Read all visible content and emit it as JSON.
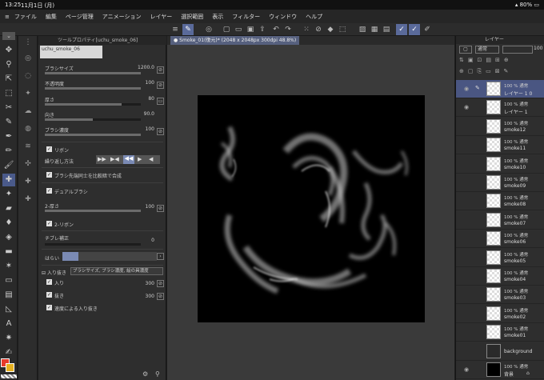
{
  "status": {
    "time": "13:25",
    "date": "11月1日 (月)",
    "battery": "80%"
  },
  "menu": [
    "ファイル",
    "編集",
    "ページ管理",
    "アニメーション",
    "レイヤー",
    "選択範囲",
    "表示",
    "フィルター",
    "ウィンドウ",
    "ヘルプ"
  ],
  "tool_property": {
    "tab_title": "ツールプロパティ[uchu_smoke_06]",
    "preset_name": "uchu_smoke_06",
    "brush_size": {
      "label": "ブラシサイズ",
      "value": "1200.0",
      "fraction": 1.0
    },
    "opacity": {
      "label": "不透明度",
      "value": "100",
      "fraction": 1.0
    },
    "thickness": {
      "label": "厚さ",
      "value": "80",
      "fraction": 0.8
    },
    "direction": {
      "label": "向き",
      "value": "90.0",
      "fraction": 0.5
    },
    "brush_density": {
      "label": "ブラシ濃度",
      "value": "100",
      "fraction": 1.0
    },
    "ribbon": {
      "label": "リボン",
      "checked": true
    },
    "repeat_method": {
      "label": "繰り返し方法"
    },
    "tip_multiply": {
      "label": "ブラシ先端同士を比較暗で合成",
      "checked": true
    },
    "dual_brush": {
      "label": "デュアルブラシ",
      "checked": true
    },
    "thickness2": {
      "label": "2-厚さ",
      "value": "100",
      "fraction": 1.0
    },
    "ribbon2": {
      "label": "2-リボン",
      "checked": true
    },
    "tilt_correction": {
      "label": "チブレ補正",
      "value": "0",
      "fraction": 0.0
    },
    "flick": {
      "label": "はらい"
    },
    "taper": {
      "label": "入り抜き",
      "value": "ブラシサイズ, ブラシ濃度, 絵の具濃度"
    },
    "taper_in": {
      "label": "入り",
      "value": "300",
      "checked": true
    },
    "taper_out": {
      "label": "抜き",
      "value": "300",
      "checked": true
    },
    "speed_taper": {
      "label": "速度による入り抜き",
      "checked": true
    }
  },
  "canvas": {
    "tab_label": "Smoke_01(復元)* (2048 x 2048px 300dpi 48.8%)"
  },
  "layers_panel": {
    "title": "レイヤー",
    "blend_mode": "通常",
    "opacity_value": "100",
    "layers": [
      {
        "opacity": "100 % 通常",
        "name": "レイヤー 1 0",
        "visible": true,
        "thumb": "pen",
        "selected": true
      },
      {
        "opacity": "100 % 通常",
        "name": "レイヤー 1",
        "visible": true,
        "thumb": "checker"
      },
      {
        "opacity": "100 % 通常",
        "name": "smoke12",
        "visible": false,
        "thumb": "checker"
      },
      {
        "opacity": "100 % 通常",
        "name": "smoke11",
        "visible": false,
        "thumb": "checker"
      },
      {
        "opacity": "100 % 通常",
        "name": "smoke10",
        "visible": false,
        "thumb": "checker"
      },
      {
        "opacity": "100 % 通常",
        "name": "smoke09",
        "visible": false,
        "thumb": "checker"
      },
      {
        "opacity": "100 % 通常",
        "name": "smoke08",
        "visible": false,
        "thumb": "checker"
      },
      {
        "opacity": "100 % 通常",
        "name": "smoke07",
        "visible": false,
        "thumb": "checker"
      },
      {
        "opacity": "100 % 通常",
        "name": "smoke06",
        "visible": false,
        "thumb": "checker"
      },
      {
        "opacity": "100 % 通常",
        "name": "smoke05",
        "visible": false,
        "thumb": "checker"
      },
      {
        "opacity": "100 % 通常",
        "name": "smoke04",
        "visible": false,
        "thumb": "checker"
      },
      {
        "opacity": "100 % 通常",
        "name": "smoke03",
        "visible": false,
        "thumb": "checker"
      },
      {
        "opacity": "100 % 通常",
        "name": "smoke02",
        "visible": false,
        "thumb": "checker"
      },
      {
        "opacity": "100 % 通常",
        "name": "smoke01",
        "visible": false,
        "thumb": "checker"
      },
      {
        "opacity": "",
        "name": "background",
        "visible": false,
        "thumb": "dark"
      },
      {
        "opacity": "100 % 通常",
        "name": "背景",
        "visible": true,
        "thumb": "black",
        "locked": true
      }
    ]
  },
  "colors": {
    "main": "#e53a2a",
    "sub": "#e5b020",
    "accent": "#5a6a9a"
  }
}
